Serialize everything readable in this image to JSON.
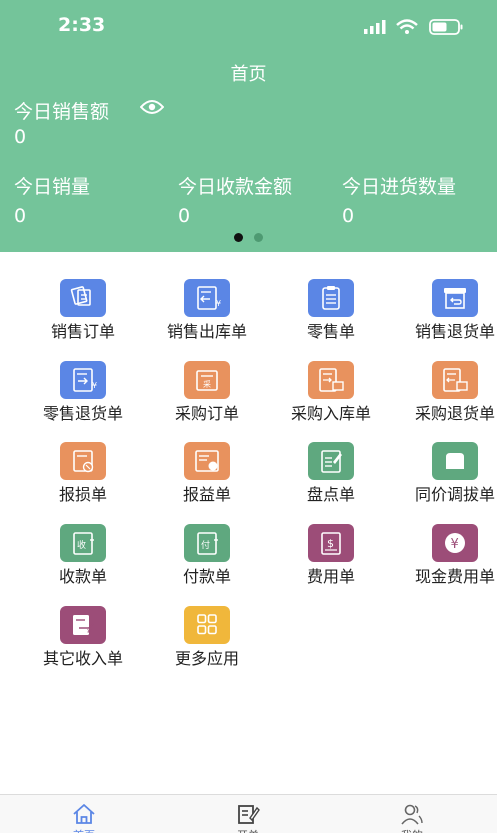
{
  "status_bar": {
    "time": "2:33"
  },
  "header": {
    "title": "首页",
    "today_sales_label": "今日销售额",
    "today_sales_value": "0",
    "stats": [
      {
        "label": "今日销量",
        "value": "0"
      },
      {
        "label": "今日收款金额",
        "value": "0"
      },
      {
        "label": "今日进货数量",
        "value": "0"
      }
    ],
    "page_dots": {
      "count": 2,
      "active": 0
    }
  },
  "grid": [
    {
      "label": "销售订单",
      "icon": "documents-icon",
      "color": "#5b86e5"
    },
    {
      "label": "销售出库单",
      "icon": "doc-out-yen-icon",
      "color": "#5b86e5"
    },
    {
      "label": "零售单",
      "icon": "clipboard-icon",
      "color": "#5b86e5"
    },
    {
      "label": "销售退货单",
      "icon": "return-box-icon",
      "color": "#5b86e5"
    },
    {
      "label": "零售退货单",
      "icon": "doc-return-yen-icon",
      "color": "#5b86e5"
    },
    {
      "label": "采购订单",
      "icon": "purchase-order-icon",
      "color": "#e8925e"
    },
    {
      "label": "采购入库单",
      "icon": "doc-in-box-icon",
      "color": "#e8925e"
    },
    {
      "label": "采购退货单",
      "icon": "doc-return-box-icon",
      "color": "#e8925e"
    },
    {
      "label": "报损单",
      "icon": "loss-doc-icon",
      "color": "#e8925e"
    },
    {
      "label": "报益单",
      "icon": "gain-doc-icon",
      "color": "#e8925e"
    },
    {
      "label": "盘点单",
      "icon": "inventory-check-icon",
      "color": "#5fa87f"
    },
    {
      "label": "同价调拔单",
      "icon": "transfer-box-icon",
      "color": "#5fa87f"
    },
    {
      "label": "收款单",
      "icon": "receipt-doc-icon",
      "color": "#5fa87f"
    },
    {
      "label": "付款单",
      "icon": "payment-doc-icon",
      "color": "#5fa87f"
    },
    {
      "label": "费用单",
      "icon": "expense-dollar-icon",
      "color": "#9c4d78"
    },
    {
      "label": "现金费用单",
      "icon": "cash-yen-icon",
      "color": "#9c4d78"
    },
    {
      "label": "其它收入单",
      "icon": "other-income-icon",
      "color": "#9c4d78"
    },
    {
      "label": "更多应用",
      "icon": "apps-grid-icon",
      "color": "#f0b73b"
    }
  ],
  "tabbar": [
    {
      "label": "首页",
      "icon": "home-icon",
      "active": true
    },
    {
      "label": "开单",
      "icon": "edit-doc-icon",
      "active": false
    },
    {
      "label": "我的",
      "icon": "user-icon",
      "active": false
    }
  ],
  "colors": {
    "header_bg": "#74c49a",
    "tab_active": "#5b86e5",
    "tab_inactive": "#555555"
  }
}
